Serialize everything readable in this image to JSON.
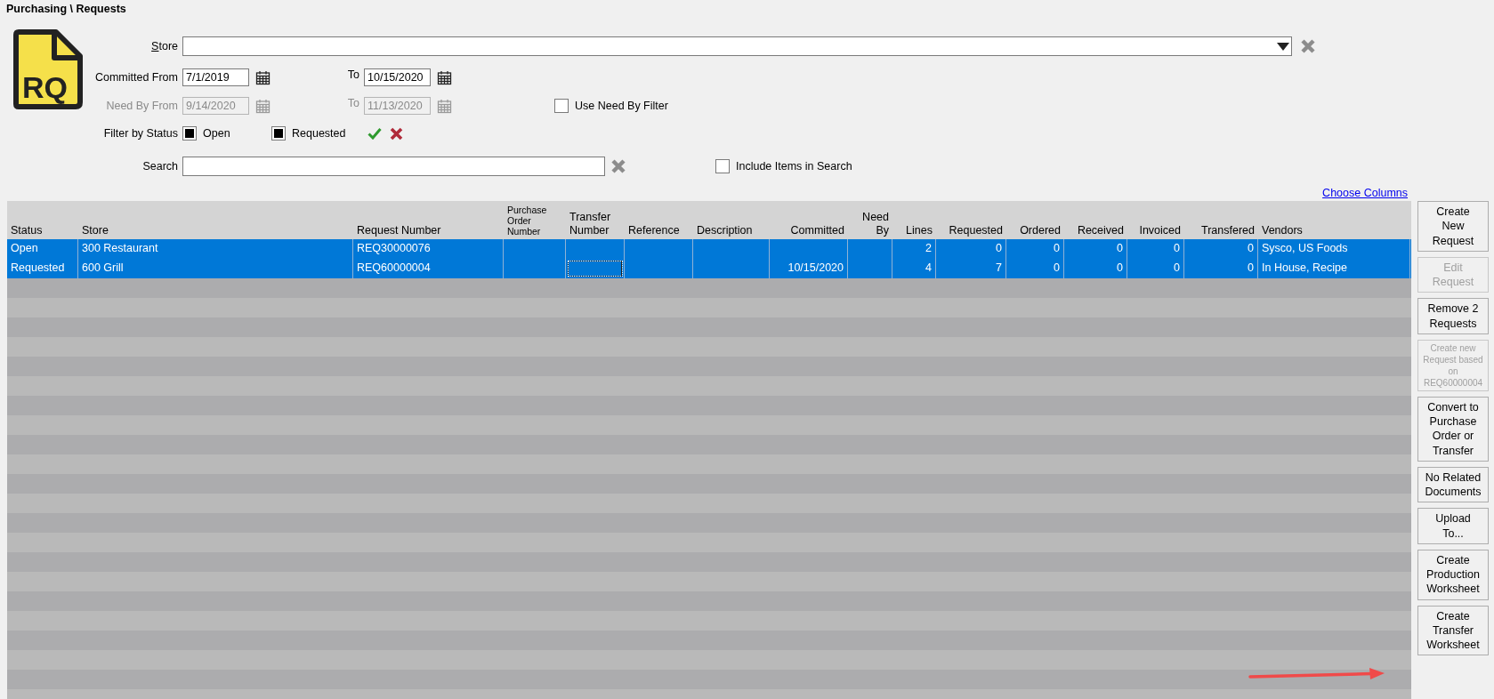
{
  "page_title": "Purchasing \\ Requests",
  "icon_text": "RQ",
  "filters": {
    "store": {
      "label": "Store",
      "mnemonic": true
    },
    "committed": {
      "label": "Committed From",
      "from": "7/1/2019",
      "to_label": "To",
      "to": "10/15/2020",
      "disabled": false
    },
    "need_by": {
      "label": "Need By From",
      "from": "9/14/2020",
      "to_label": "To",
      "to": "11/13/2020",
      "disabled": true
    },
    "use_need_by": {
      "label": "Use Need By Filter",
      "checked": false
    },
    "status": {
      "label": "Filter by Status",
      "options": [
        {
          "label": "Open",
          "checked": true
        },
        {
          "label": "Requested",
          "checked": true
        }
      ]
    },
    "search": {
      "label": "Search"
    },
    "include_items": {
      "label": "Include Items in Search",
      "checked": false
    }
  },
  "choose_columns": "Choose Columns",
  "table": {
    "columns": [
      {
        "label": "Status",
        "kind": "text"
      },
      {
        "label": "Store",
        "kind": "text"
      },
      {
        "label": "Request Number",
        "kind": "text"
      },
      {
        "label": "Purchase Order Number",
        "kind": "po"
      },
      {
        "label": "Transfer Number",
        "kind": "transfer"
      },
      {
        "label": "Reference",
        "kind": "text"
      },
      {
        "label": "Description",
        "kind": "text"
      },
      {
        "label": "Committed",
        "kind": "number"
      },
      {
        "label": "Need By",
        "kind": "number"
      },
      {
        "label": "Lines",
        "kind": "number"
      },
      {
        "label": "Requested",
        "kind": "number"
      },
      {
        "label": "Ordered",
        "kind": "number"
      },
      {
        "label": "Received",
        "kind": "number"
      },
      {
        "label": "Invoiced",
        "kind": "number"
      },
      {
        "label": "Transfered",
        "kind": "number"
      },
      {
        "label": "Vendors",
        "kind": "text"
      }
    ],
    "rows": [
      {
        "selected": true,
        "focused": false,
        "cells": [
          "Open",
          "300 Restaurant",
          "REQ30000076",
          "",
          "",
          "",
          "",
          "",
          "",
          "2",
          "0",
          "0",
          "0",
          "0",
          "0",
          "Sysco, US Foods"
        ]
      },
      {
        "selected": true,
        "focused": true,
        "cells": [
          "Requested",
          "600 Grill",
          "REQ60000004",
          "",
          "",
          "",
          "",
          "10/15/2020",
          "",
          "4",
          "7",
          "0",
          "0",
          "0",
          "0",
          "In House, Recipe"
        ]
      }
    ]
  },
  "actions": [
    {
      "label": "Create New Request",
      "disabled": false,
      "kind": "normal"
    },
    {
      "label": "Edit Request",
      "disabled": true,
      "kind": "normal"
    },
    {
      "label": "Remove 2 Requests",
      "disabled": false,
      "kind": "normal"
    },
    {
      "label": "Create new Request based on REQ60000004",
      "disabled": true,
      "kind": "small"
    },
    {
      "label": "Convert to Purchase Order or Transfer",
      "disabled": false,
      "kind": "normal"
    },
    {
      "label": "No Related Documents",
      "disabled": false,
      "kind": "normal"
    },
    {
      "label": "Upload To...",
      "disabled": false,
      "kind": "normal"
    },
    {
      "label": "Create Production Worksheet",
      "disabled": false,
      "kind": "normal"
    },
    {
      "label": "Create Transfer Worksheet",
      "disabled": false,
      "kind": "normal"
    }
  ]
}
